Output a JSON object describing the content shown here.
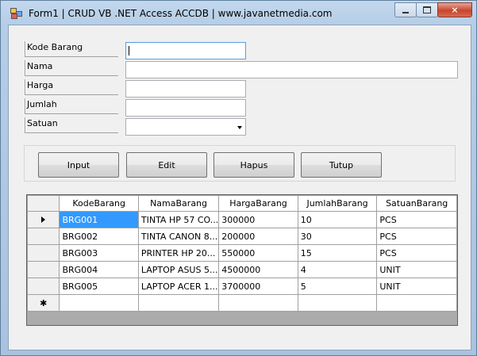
{
  "window": {
    "title": "Form1 | CRUD VB .NET Access ACCDB | www.javanetmedia.com",
    "close_glyph": "×"
  },
  "form": {
    "kode_label": "Kode Barang",
    "nama_label": "Nama",
    "harga_label": "Harga",
    "jumlah_label": "Jumlah",
    "satuan_label": "Satuan",
    "kode_value": "",
    "nama_value": "",
    "harga_value": "",
    "jumlah_value": "",
    "satuan_value": ""
  },
  "buttons": {
    "input": "Input",
    "edit": "Edit",
    "hapus": "Hapus",
    "tutup": "Tutup"
  },
  "grid": {
    "columns": [
      "KodeBarang",
      "NamaBarang",
      "HargaBarang",
      "JumlahBarang",
      "SatuanBarang"
    ],
    "rows": [
      [
        "BRG001",
        "TINTA HP 57 CO...",
        "300000",
        "10",
        "PCS"
      ],
      [
        "BRG002",
        "TINTA CANON 8...",
        "200000",
        "30",
        "PCS"
      ],
      [
        "BRG003",
        "PRINTER HP 20...",
        "550000",
        "15",
        "PCS"
      ],
      [
        "BRG004",
        "LAPTOP ASUS 5...",
        "4500000",
        "4",
        "UNIT"
      ],
      [
        "BRG005",
        "LAPTOP ACER 1...",
        "3700000",
        "5",
        "UNIT"
      ]
    ],
    "new_row_glyph": "✱"
  }
}
